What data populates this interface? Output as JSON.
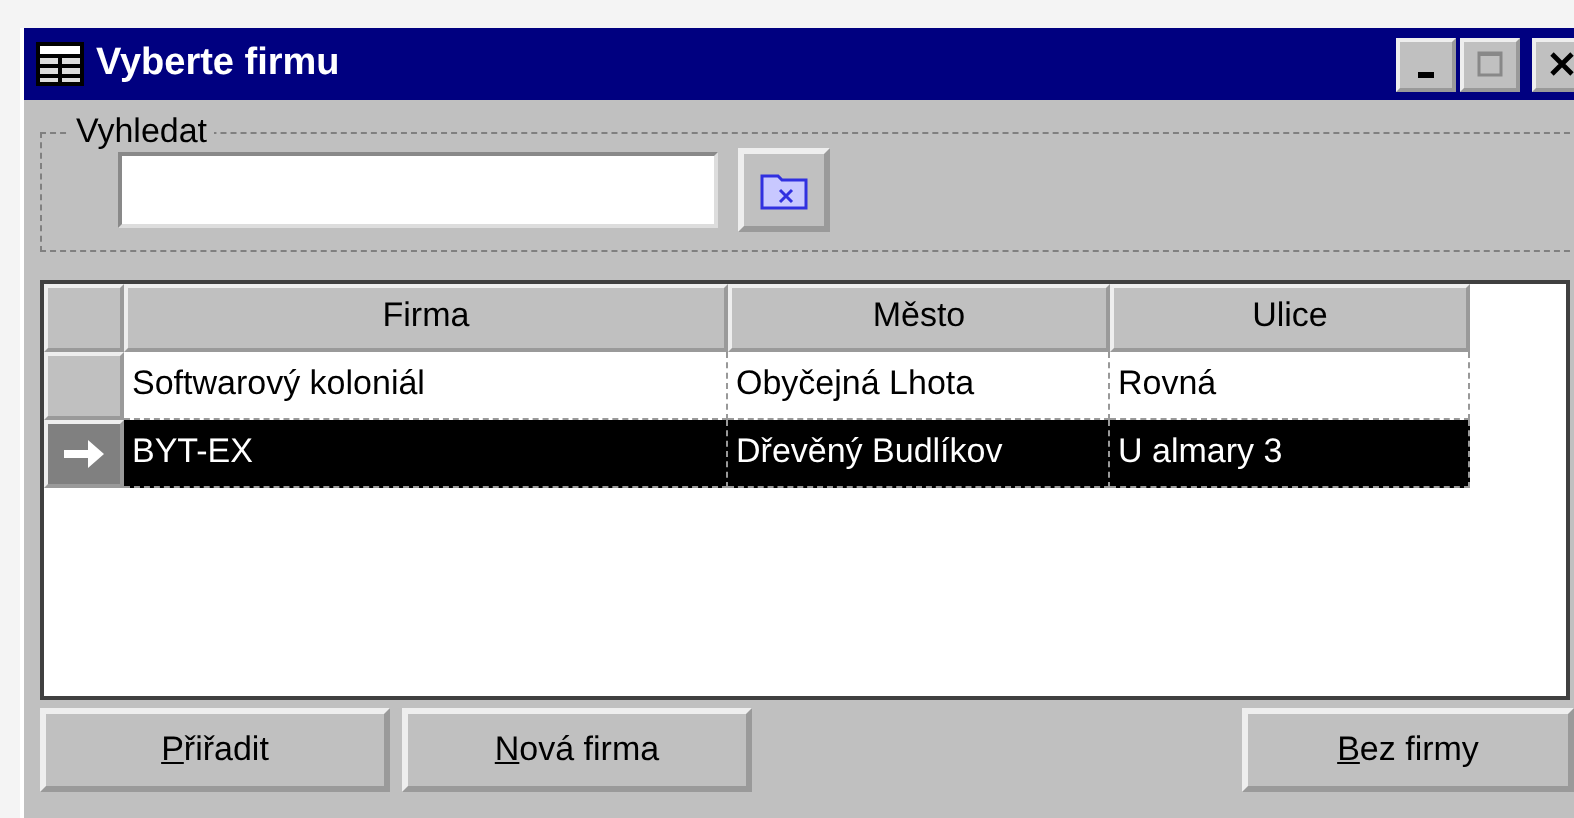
{
  "window": {
    "title": "Vyberte firmu"
  },
  "search": {
    "label": "Vyhledat"
  },
  "table": {
    "columns": [
      "Firma",
      "Město",
      "Ulice"
    ],
    "rows": [
      {
        "cells": [
          "Softwarový koloniál",
          "Obyčejná Lhota",
          "Rovná"
        ],
        "selected": false
      },
      {
        "cells": [
          "BYT-EX",
          "Dřevěný Budlíkov",
          "U almary 3"
        ],
        "selected": true
      }
    ]
  },
  "left_buttons": [
    "Přiřadit",
    "Nová firma"
  ],
  "right_buttons": [
    "Bez firmy"
  ]
}
